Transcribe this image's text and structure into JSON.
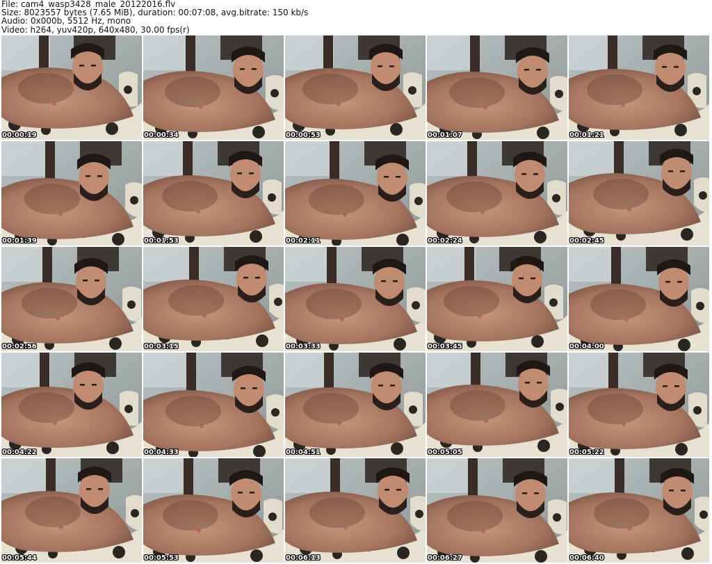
{
  "header": {
    "file_line": "File: cam4_wasp3428_male_20122016.flv",
    "size_line": "Size: 8023557 bytes (7.65 MiB), duration: 00:07:08, avg.bitrate: 150 kb/s",
    "audio_line": "Audio: 0x000b, 5512 Hz, mono",
    "video_line": "Video: h264, yuv420p, 640x480, 30.00 fps(r)"
  },
  "thumbnails": [
    {
      "timestamp": "00:00:19"
    },
    {
      "timestamp": "00:00:34"
    },
    {
      "timestamp": "00:00:53"
    },
    {
      "timestamp": "00:01:07"
    },
    {
      "timestamp": "00:01:21"
    },
    {
      "timestamp": "00:01:39"
    },
    {
      "timestamp": "00:01:53"
    },
    {
      "timestamp": "00:02:11"
    },
    {
      "timestamp": "00:02:24"
    },
    {
      "timestamp": "00:02:45"
    },
    {
      "timestamp": "00:02:56"
    },
    {
      "timestamp": "00:03:15"
    },
    {
      "timestamp": "00:03:33"
    },
    {
      "timestamp": "00:03:45"
    },
    {
      "timestamp": "00:04:00"
    },
    {
      "timestamp": "00:04:22"
    },
    {
      "timestamp": "00:04:33"
    },
    {
      "timestamp": "00:04:51"
    },
    {
      "timestamp": "00:05:05"
    },
    {
      "timestamp": "00:05:22"
    },
    {
      "timestamp": "00:05:44"
    },
    {
      "timestamp": "00:05:53"
    },
    {
      "timestamp": "00:06:13"
    },
    {
      "timestamp": "00:06:27"
    },
    {
      "timestamp": "00:06:40"
    }
  ]
}
